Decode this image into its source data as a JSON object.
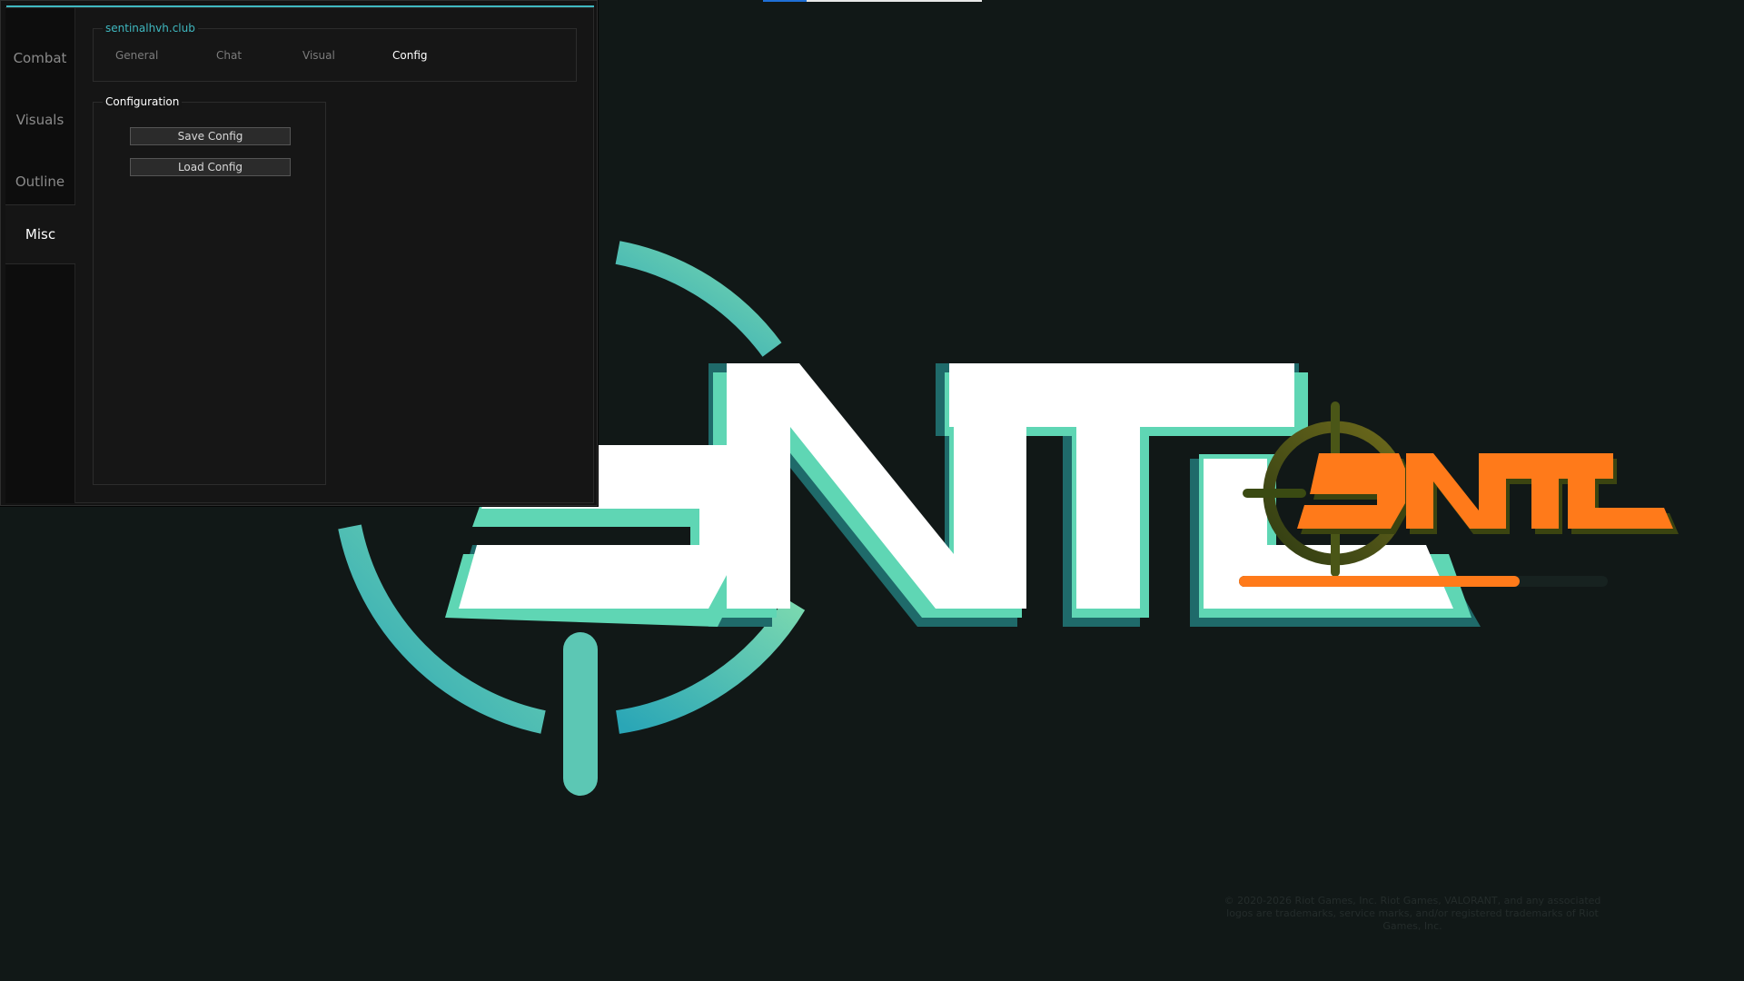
{
  "menu": {
    "brand": "sentinalhvh.club",
    "sidebar": {
      "items": [
        {
          "label": "Combat"
        },
        {
          "label": "Visuals"
        },
        {
          "label": "Outline"
        },
        {
          "label": "Misc"
        }
      ],
      "active": "Misc"
    },
    "tabs": [
      {
        "label": "General"
      },
      {
        "label": "Chat"
      },
      {
        "label": "Visual"
      },
      {
        "label": "Config"
      }
    ],
    "active_tab": "Config",
    "config_group": {
      "title": "Configuration",
      "save_label": "Save Config",
      "load_label": "Load Config"
    }
  },
  "background": {
    "logo_large_text": "SNT",
    "logo_small_text": "SNTL",
    "copyright": "© 2020-2026 Riot Games, Inc. Riot Games, VALORANT, and any associated logos are trademarks, service marks, and/or registered trademarks of Riot Games, Inc.",
    "loading_progress": 0.76
  },
  "colors": {
    "accent": "#3fb8c0",
    "background": "#111817",
    "logo_teal": "#5fd6b4",
    "logo_orange": "#ff7a1a",
    "logo_olive": "#4d5a1c"
  },
  "icons": {
    "large_logo": "crosshair-logo-icon",
    "small_logo": "crosshair-logo-icon"
  }
}
